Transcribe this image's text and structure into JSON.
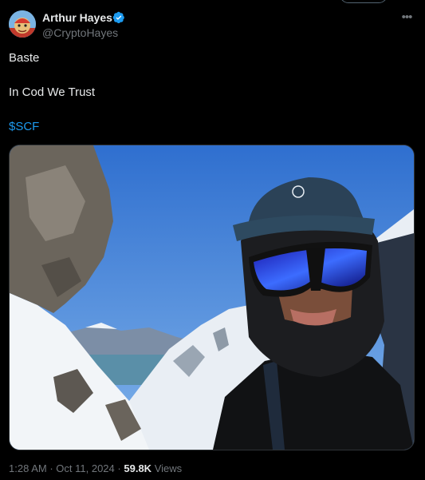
{
  "author": {
    "name": "Arthur Hayes",
    "handle": "@CryptoHayes",
    "verified": true,
    "verified_color": "#1d9bf0"
  },
  "tweet": {
    "lines": [
      "Baste",
      "In Cod We Trust"
    ],
    "cashtag": "$SCF",
    "cashtag_color": "#1d9bf0"
  },
  "media": {
    "type": "photo",
    "icons": [
      "selfie-photo"
    ]
  },
  "meta": {
    "time": "1:28 AM",
    "separator": "·",
    "date": "Oct 11, 2024",
    "views_count": "59.8K",
    "views_label": "Views"
  },
  "menu": {
    "more_icon": "more-dots-icon"
  }
}
